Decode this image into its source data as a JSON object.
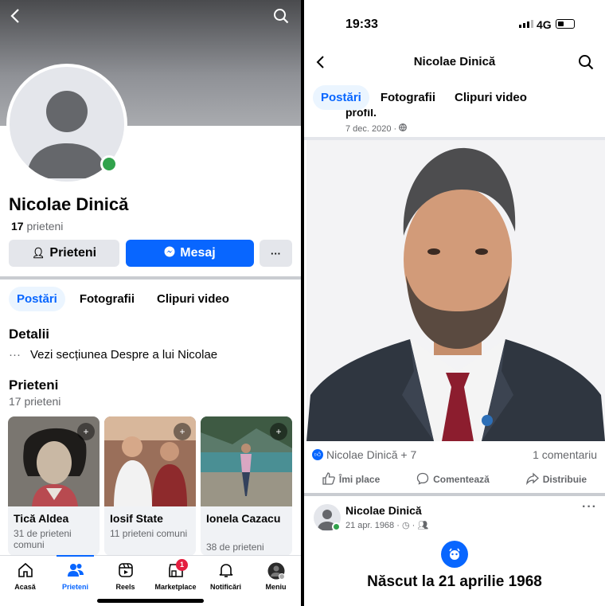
{
  "left": {
    "header": {
      "back_icon": "chevron-left-icon",
      "search_icon": "search-icon"
    },
    "profile": {
      "name": "Nicolae Dinică",
      "friends_count": "17",
      "friends_label": "prieteni",
      "friends_button": "Prieteni",
      "message_button": "Mesaj",
      "more_button": "···"
    },
    "tabs": [
      "Postări",
      "Fotografii",
      "Clipuri video"
    ],
    "details": {
      "title": "Detalii",
      "ellipsis": "···",
      "text": "Vezi secțiunea Despre a lui Nicolae"
    },
    "friends_section": {
      "title": "Prieteni",
      "count_text": "17 prieteni",
      "cards": [
        {
          "name": "Tică Aldea",
          "mutual": "31 de prieteni comuni"
        },
        {
          "name": "Iosif State",
          "mutual": "11 prieteni comuni"
        },
        {
          "name": "Ionela Cazacu",
          "mutual": "38 de prieteni"
        }
      ]
    },
    "bottom_nav": [
      {
        "label": "Acasă",
        "icon": "home-icon"
      },
      {
        "label": "Prieteni",
        "icon": "friends-icon",
        "active": true
      },
      {
        "label": "Reels",
        "icon": "reels-icon"
      },
      {
        "label": "Marketplace",
        "icon": "marketplace-icon",
        "badge": "1"
      },
      {
        "label": "Notificări",
        "icon": "bell-icon"
      },
      {
        "label": "Meniu",
        "icon": "avatar-icon"
      }
    ]
  },
  "right": {
    "status_bar": {
      "time": "19:33",
      "network": "4G"
    },
    "header": {
      "title": "Nicolae Dinică"
    },
    "tabs": [
      "Postări",
      "Fotografii",
      "Clipuri video"
    ],
    "post1": {
      "snippet": "profil.",
      "date": "7 dec. 2020 ·",
      "reactions": "Nicolae Dinică + 7",
      "comments": "1 comentariu",
      "actions": [
        "Îmi place",
        "Comentează",
        "Distribuie"
      ]
    },
    "post2": {
      "author": "Nicolae Dinică",
      "date": "21 apr. 1968 ·",
      "event": "Născut la 21 aprilie 1968"
    }
  }
}
